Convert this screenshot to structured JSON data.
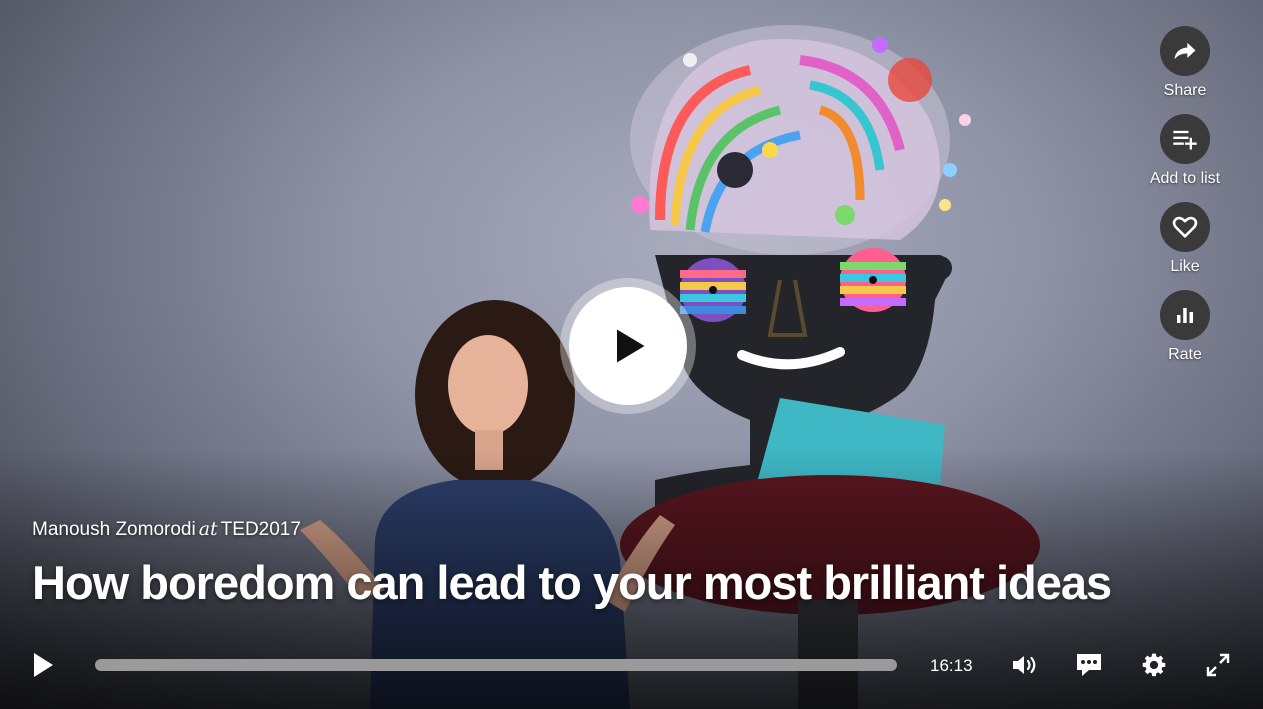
{
  "video": {
    "speaker": "Manoush Zomorodi",
    "at": "at",
    "event": "TED2017",
    "title": "How boredom can lead to your most brilliant ideas",
    "duration": "16:13",
    "progress_fraction": 0
  },
  "actions": [
    {
      "label": "Share",
      "icon": "share-icon"
    },
    {
      "label": "Add to list",
      "icon": "playlist-add-icon"
    },
    {
      "label": "Like",
      "icon": "heart-icon"
    },
    {
      "label": "Rate",
      "icon": "bar-chart-icon"
    }
  ],
  "controls": {
    "play_icon": "play-icon",
    "volume_icon": "volume-icon",
    "captions_icon": "captions-icon",
    "settings_icon": "gear-icon",
    "fullscreen_icon": "fullscreen-icon"
  },
  "colors": {
    "action_circle": "#3a3a3a",
    "progress_track": "#9a9a9a",
    "text": "#ffffff"
  }
}
